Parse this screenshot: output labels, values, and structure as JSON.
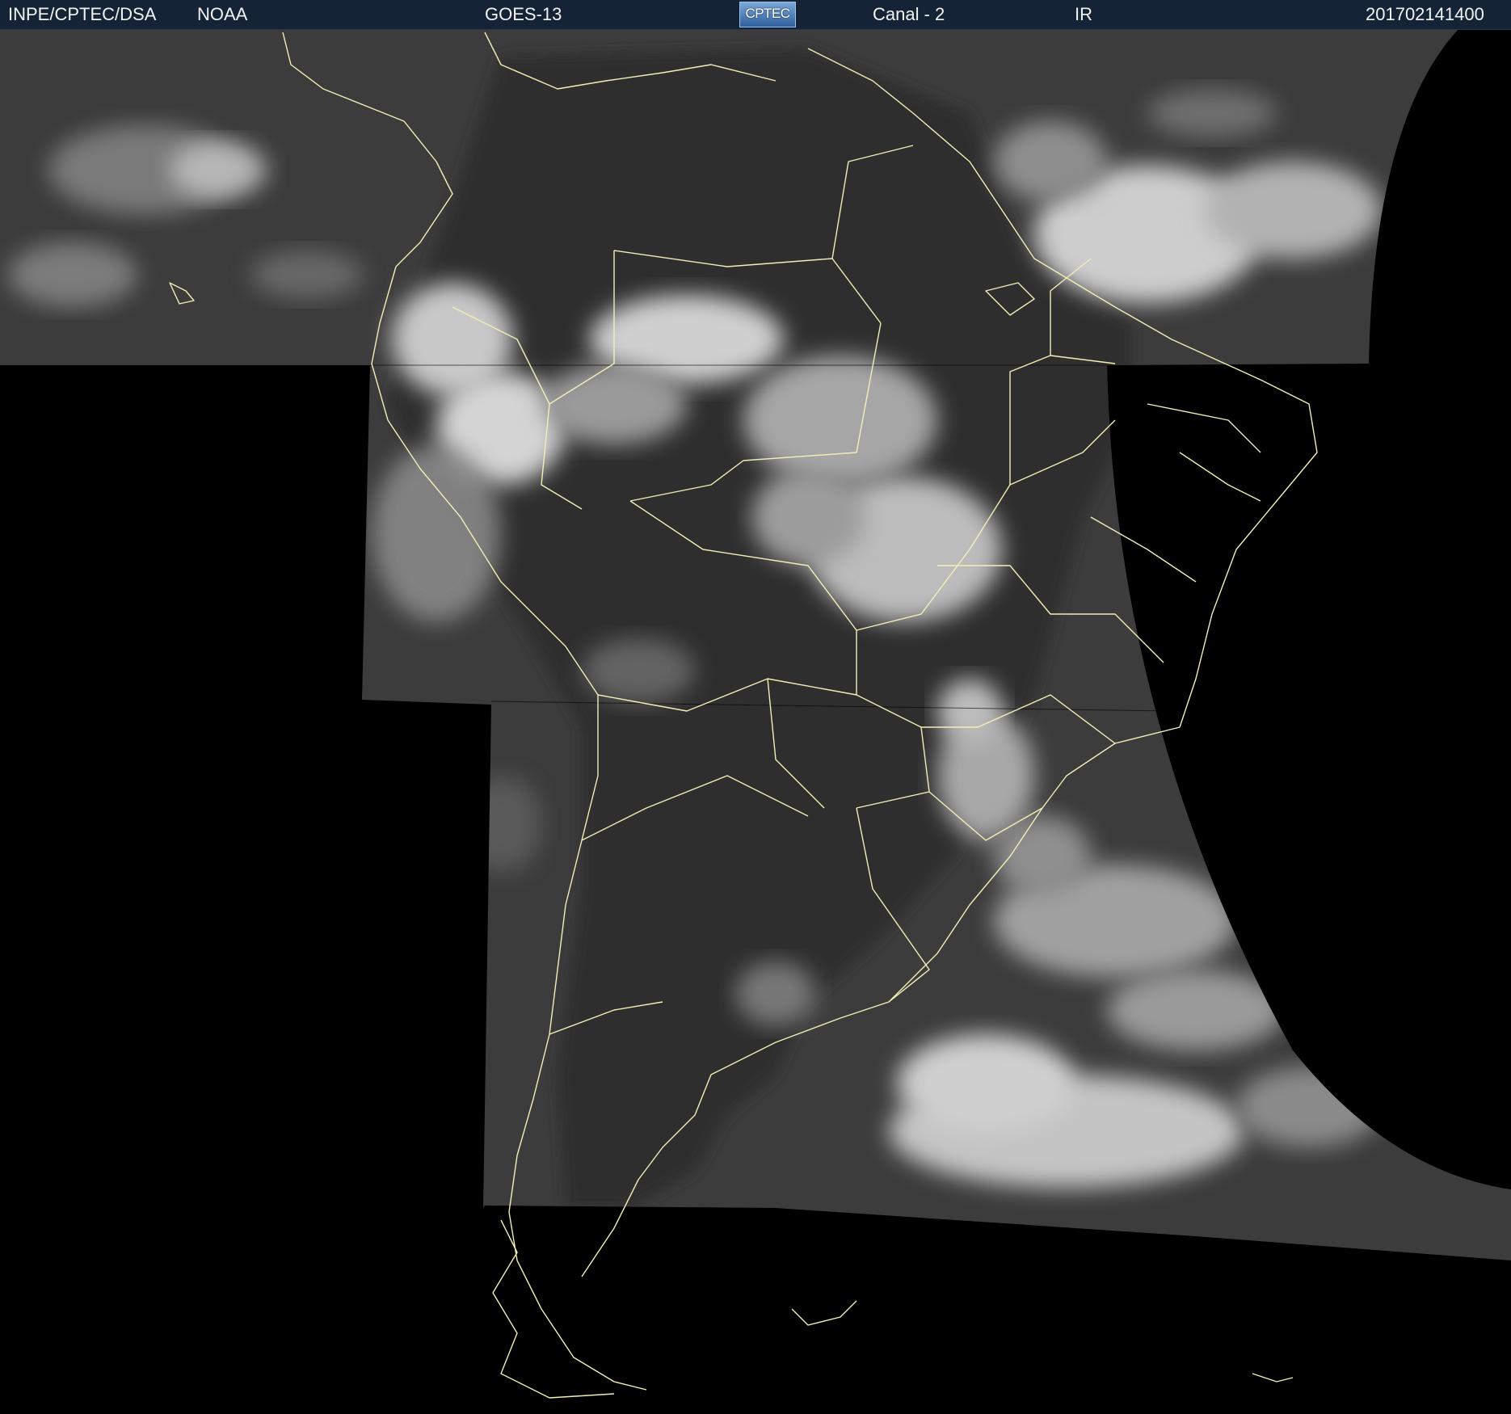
{
  "header": {
    "source": "INPE/CPTEC/DSA",
    "agency": "NOAA",
    "satellite": "GOES-13",
    "logo_text": "CPTEC",
    "channel": "Canal - 2",
    "band": "IR",
    "timestamp": "201702141400"
  },
  "imagery": {
    "background_color": "#000000",
    "cloud_base_color": "#3c3c3c",
    "cloud_bright_color": "#d6d6d6",
    "border_color": "#f2efb4"
  }
}
